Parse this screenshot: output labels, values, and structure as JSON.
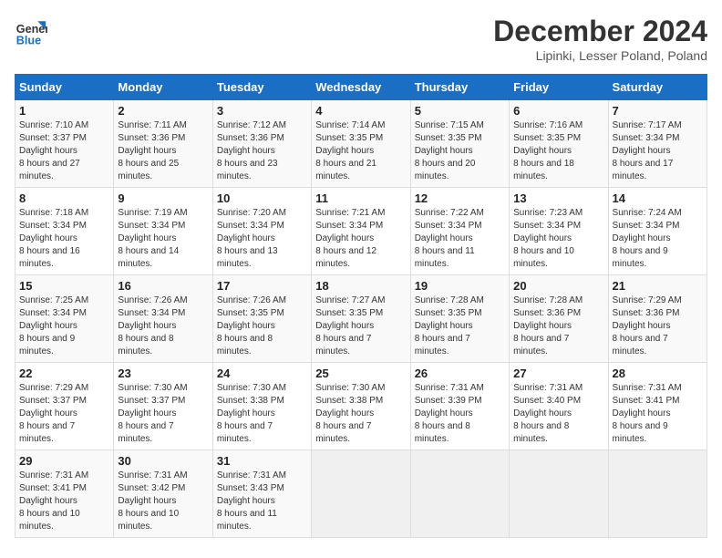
{
  "logo": {
    "line1": "General",
    "line2": "Blue"
  },
  "title": "December 2024",
  "location": "Lipinki, Lesser Poland, Poland",
  "days_of_week": [
    "Sunday",
    "Monday",
    "Tuesday",
    "Wednesday",
    "Thursday",
    "Friday",
    "Saturday"
  ],
  "weeks": [
    [
      {
        "day": "1",
        "sunrise": "7:10 AM",
        "sunset": "3:37 PM",
        "daylight": "8 hours and 27 minutes."
      },
      {
        "day": "2",
        "sunrise": "7:11 AM",
        "sunset": "3:36 PM",
        "daylight": "8 hours and 25 minutes."
      },
      {
        "day": "3",
        "sunrise": "7:12 AM",
        "sunset": "3:36 PM",
        "daylight": "8 hours and 23 minutes."
      },
      {
        "day": "4",
        "sunrise": "7:14 AM",
        "sunset": "3:35 PM",
        "daylight": "8 hours and 21 minutes."
      },
      {
        "day": "5",
        "sunrise": "7:15 AM",
        "sunset": "3:35 PM",
        "daylight": "8 hours and 20 minutes."
      },
      {
        "day": "6",
        "sunrise": "7:16 AM",
        "sunset": "3:35 PM",
        "daylight": "8 hours and 18 minutes."
      },
      {
        "day": "7",
        "sunrise": "7:17 AM",
        "sunset": "3:34 PM",
        "daylight": "8 hours and 17 minutes."
      }
    ],
    [
      {
        "day": "8",
        "sunrise": "7:18 AM",
        "sunset": "3:34 PM",
        "daylight": "8 hours and 16 minutes."
      },
      {
        "day": "9",
        "sunrise": "7:19 AM",
        "sunset": "3:34 PM",
        "daylight": "8 hours and 14 minutes."
      },
      {
        "day": "10",
        "sunrise": "7:20 AM",
        "sunset": "3:34 PM",
        "daylight": "8 hours and 13 minutes."
      },
      {
        "day": "11",
        "sunrise": "7:21 AM",
        "sunset": "3:34 PM",
        "daylight": "8 hours and 12 minutes."
      },
      {
        "day": "12",
        "sunrise": "7:22 AM",
        "sunset": "3:34 PM",
        "daylight": "8 hours and 11 minutes."
      },
      {
        "day": "13",
        "sunrise": "7:23 AM",
        "sunset": "3:34 PM",
        "daylight": "8 hours and 10 minutes."
      },
      {
        "day": "14",
        "sunrise": "7:24 AM",
        "sunset": "3:34 PM",
        "daylight": "8 hours and 9 minutes."
      }
    ],
    [
      {
        "day": "15",
        "sunrise": "7:25 AM",
        "sunset": "3:34 PM",
        "daylight": "8 hours and 9 minutes."
      },
      {
        "day": "16",
        "sunrise": "7:26 AM",
        "sunset": "3:34 PM",
        "daylight": "8 hours and 8 minutes."
      },
      {
        "day": "17",
        "sunrise": "7:26 AM",
        "sunset": "3:35 PM",
        "daylight": "8 hours and 8 minutes."
      },
      {
        "day": "18",
        "sunrise": "7:27 AM",
        "sunset": "3:35 PM",
        "daylight": "8 hours and 7 minutes."
      },
      {
        "day": "19",
        "sunrise": "7:28 AM",
        "sunset": "3:35 PM",
        "daylight": "8 hours and 7 minutes."
      },
      {
        "day": "20",
        "sunrise": "7:28 AM",
        "sunset": "3:36 PM",
        "daylight": "8 hours and 7 minutes."
      },
      {
        "day": "21",
        "sunrise": "7:29 AM",
        "sunset": "3:36 PM",
        "daylight": "8 hours and 7 minutes."
      }
    ],
    [
      {
        "day": "22",
        "sunrise": "7:29 AM",
        "sunset": "3:37 PM",
        "daylight": "8 hours and 7 minutes."
      },
      {
        "day": "23",
        "sunrise": "7:30 AM",
        "sunset": "3:37 PM",
        "daylight": "8 hours and 7 minutes."
      },
      {
        "day": "24",
        "sunrise": "7:30 AM",
        "sunset": "3:38 PM",
        "daylight": "8 hours and 7 minutes."
      },
      {
        "day": "25",
        "sunrise": "7:30 AM",
        "sunset": "3:38 PM",
        "daylight": "8 hours and 7 minutes."
      },
      {
        "day": "26",
        "sunrise": "7:31 AM",
        "sunset": "3:39 PM",
        "daylight": "8 hours and 8 minutes."
      },
      {
        "day": "27",
        "sunrise": "7:31 AM",
        "sunset": "3:40 PM",
        "daylight": "8 hours and 8 minutes."
      },
      {
        "day": "28",
        "sunrise": "7:31 AM",
        "sunset": "3:41 PM",
        "daylight": "8 hours and 9 minutes."
      }
    ],
    [
      {
        "day": "29",
        "sunrise": "7:31 AM",
        "sunset": "3:41 PM",
        "daylight": "8 hours and 10 minutes."
      },
      {
        "day": "30",
        "sunrise": "7:31 AM",
        "sunset": "3:42 PM",
        "daylight": "8 hours and 10 minutes."
      },
      {
        "day": "31",
        "sunrise": "7:31 AM",
        "sunset": "3:43 PM",
        "daylight": "8 hours and 11 minutes."
      },
      null,
      null,
      null,
      null
    ]
  ]
}
